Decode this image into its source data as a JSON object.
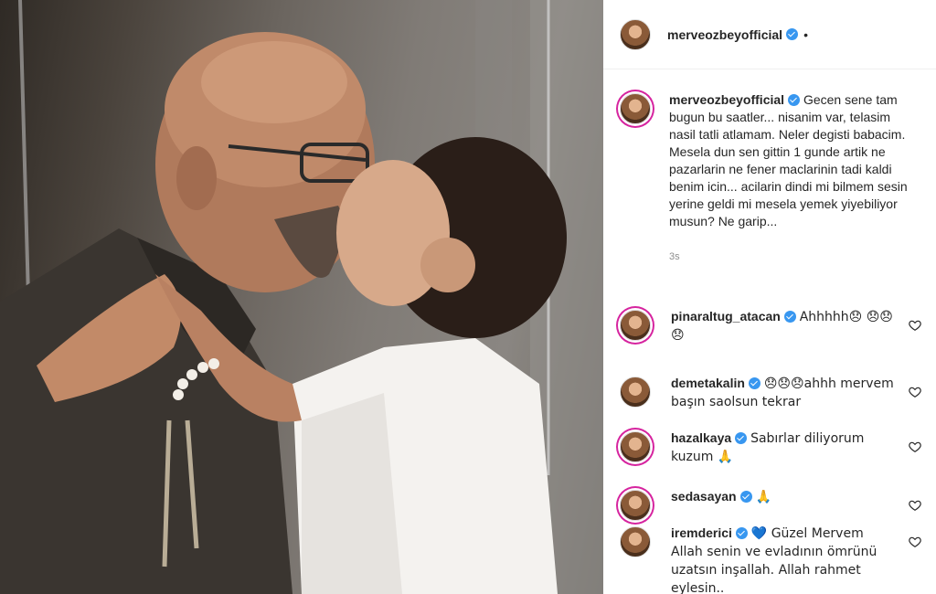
{
  "post": {
    "username": "merveozbeyofficial",
    "header_dot": "•"
  },
  "caption": {
    "username": "merveozbeyofficial",
    "text": "Gecen sene tam bugun bu saatler... nisanim var, telasim nasil tatli atlamam. Neler degisti babacim. Mesela dun sen gittin 1 gunde artik ne pazarlarin ne fener maclarinin tadi kaldi benim icin... acilarin dindi mi bilmem sesin yerine geldi mi mesela yemek yiyebiliyor musun? Ne garip...",
    "time": "3s"
  },
  "comments": [
    {
      "username": "pinaraltug_atacan",
      "text": "Ahhhhh😞 😞😞😞"
    },
    {
      "username": "demetakalin",
      "text": "😞😞😞ahhh mervem başın saolsun tekrar"
    },
    {
      "username": "hazalkaya",
      "text": "Sabırlar diliyorum kuzum 🙏"
    },
    {
      "username": "sedasayan",
      "text": "🙏"
    },
    {
      "username": "iremderici",
      "text": "💙 Güzel Mervem Allah senin ve evladının ömrünü uzatsın inşallah. Allah rahmet eylesin.."
    }
  ],
  "icons": {
    "verified": "verified-badge-icon",
    "like": "heart-icon"
  },
  "colors": {
    "verified": "#3897f0",
    "story_ring": "#d6249f",
    "text": "#262626",
    "muted": "#8e8e8e"
  }
}
